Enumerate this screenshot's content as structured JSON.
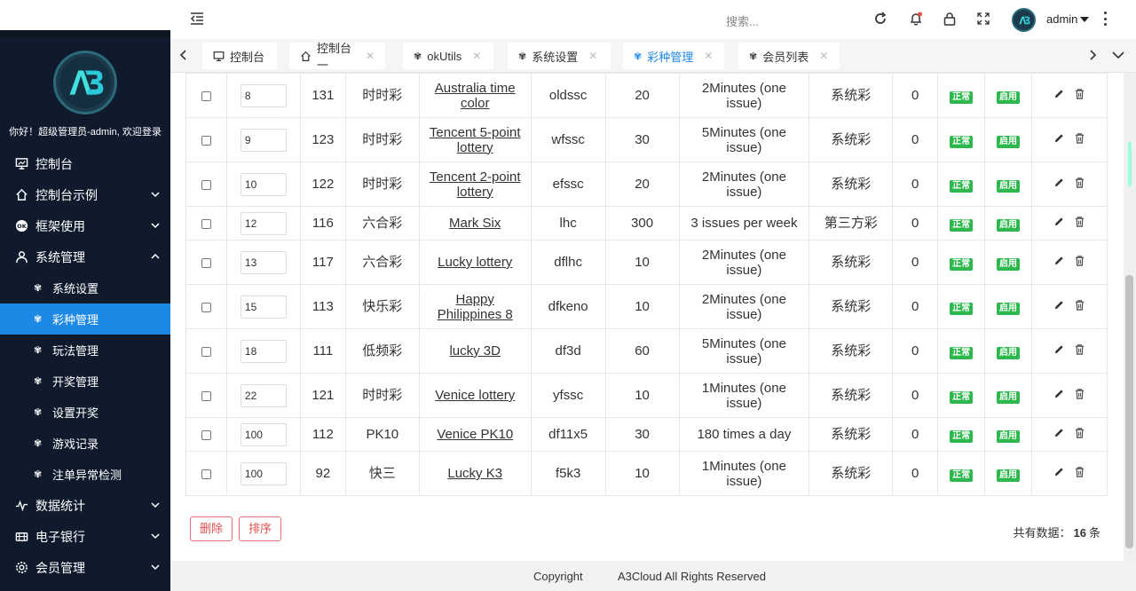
{
  "sidebar": {
    "welcome": "你好！超级管理员-admin, 欢迎登录",
    "menu": [
      {
        "label": "控制台",
        "icon": "monitor-icon"
      },
      {
        "label": "控制台示例",
        "icon": "home-icon"
      },
      {
        "label": "框架使用",
        "icon": "ok-icon"
      },
      {
        "label": "系统管理",
        "icon": "user-icon"
      }
    ],
    "submenu": [
      {
        "label": "系统设置"
      },
      {
        "label": "彩种管理"
      },
      {
        "label": "玩法管理"
      },
      {
        "label": "开奖管理"
      },
      {
        "label": "设置开奖"
      },
      {
        "label": "游戏记录"
      },
      {
        "label": "注单异常检测"
      }
    ],
    "menu_bottom": [
      {
        "label": "数据统计",
        "icon": "chart-icon"
      },
      {
        "label": "电子银行",
        "icon": "bank-icon"
      },
      {
        "label": "会员管理",
        "icon": "gear-icon"
      }
    ]
  },
  "header": {
    "search_placeholder": "搜索...",
    "username": "admin"
  },
  "tabs": [
    {
      "label": "控制台"
    },
    {
      "label": "控制台一"
    },
    {
      "label": "okUtils"
    },
    {
      "label": "系统设置"
    },
    {
      "label": "彩种管理"
    },
    {
      "label": "会员列表"
    }
  ],
  "table": {
    "rows": [
      {
        "sort": "8",
        "id": "131",
        "cat": "时时彩",
        "name": "Australia time color",
        "code": "oldssc",
        "num": "20",
        "freq": "2Minutes (one issue)",
        "type": "系统彩",
        "count": "0",
        "status": "正常",
        "enable": "启用"
      },
      {
        "sort": "9",
        "id": "123",
        "cat": "时时彩",
        "name": "Tencent 5-point lottery",
        "code": "wfssc",
        "num": "30",
        "freq": "5Minutes (one issue)",
        "type": "系统彩",
        "count": "0",
        "status": "正常",
        "enable": "启用"
      },
      {
        "sort": "10",
        "id": "122",
        "cat": "时时彩",
        "name": "Tencent 2-point lottery",
        "code": "efssc",
        "num": "20",
        "freq": "2Minutes (one issue)",
        "type": "系统彩",
        "count": "0",
        "status": "正常",
        "enable": "启用"
      },
      {
        "sort": "12",
        "id": "116",
        "cat": "六合彩",
        "name": "Mark Six",
        "code": "lhc",
        "num": "300",
        "freq": "3 issues per week",
        "type": "第三方彩",
        "count": "0",
        "status": "正常",
        "enable": "启用"
      },
      {
        "sort": "13",
        "id": "117",
        "cat": "六合彩",
        "name": "Lucky lottery",
        "code": "dflhc",
        "num": "10",
        "freq": "2Minutes (one issue)",
        "type": "系统彩",
        "count": "0",
        "status": "正常",
        "enable": "启用"
      },
      {
        "sort": "15",
        "id": "113",
        "cat": "快乐彩",
        "name": "Happy Philippines 8",
        "code": "dfkeno",
        "num": "10",
        "freq": "2Minutes (one issue)",
        "type": "系统彩",
        "count": "0",
        "status": "正常",
        "enable": "启用"
      },
      {
        "sort": "18",
        "id": "111",
        "cat": "低频彩",
        "name": "lucky 3D",
        "code": "df3d",
        "num": "60",
        "freq": "5Minutes (one issue)",
        "type": "系统彩",
        "count": "0",
        "status": "正常",
        "enable": "启用"
      },
      {
        "sort": "22",
        "id": "121",
        "cat": "时时彩",
        "name": "Venice lottery",
        "code": "yfssc",
        "num": "10",
        "freq": "1Minutes (one issue)",
        "type": "系统彩",
        "count": "0",
        "status": "正常",
        "enable": "启用"
      },
      {
        "sort": "100",
        "id": "112",
        "cat": "PK10",
        "name": "Venice PK10",
        "code": "df11x5",
        "num": "30",
        "freq": "180 times a day",
        "type": "系统彩",
        "count": "0",
        "status": "正常",
        "enable": "启用"
      },
      {
        "sort": "100",
        "id": "92",
        "cat": "快三",
        "name": "Lucky K3",
        "code": "f5k3",
        "num": "10",
        "freq": "1Minutes (one issue)",
        "type": "系统彩",
        "count": "0",
        "status": "正常",
        "enable": "启用"
      }
    ]
  },
  "footer": {
    "delete_label": "删除",
    "sort_label": "排序",
    "total_prefix": "共有数据：",
    "total_count": "16",
    "total_suffix": "条"
  },
  "copyright": {
    "label": "Copyright",
    "text": "A3Cloud All Rights Reserved"
  },
  "colors": {
    "sidebar_bg": "#0f1b2d",
    "accent": "#1e88e5",
    "badge_green": "#2db84d",
    "danger": "#e05050"
  }
}
